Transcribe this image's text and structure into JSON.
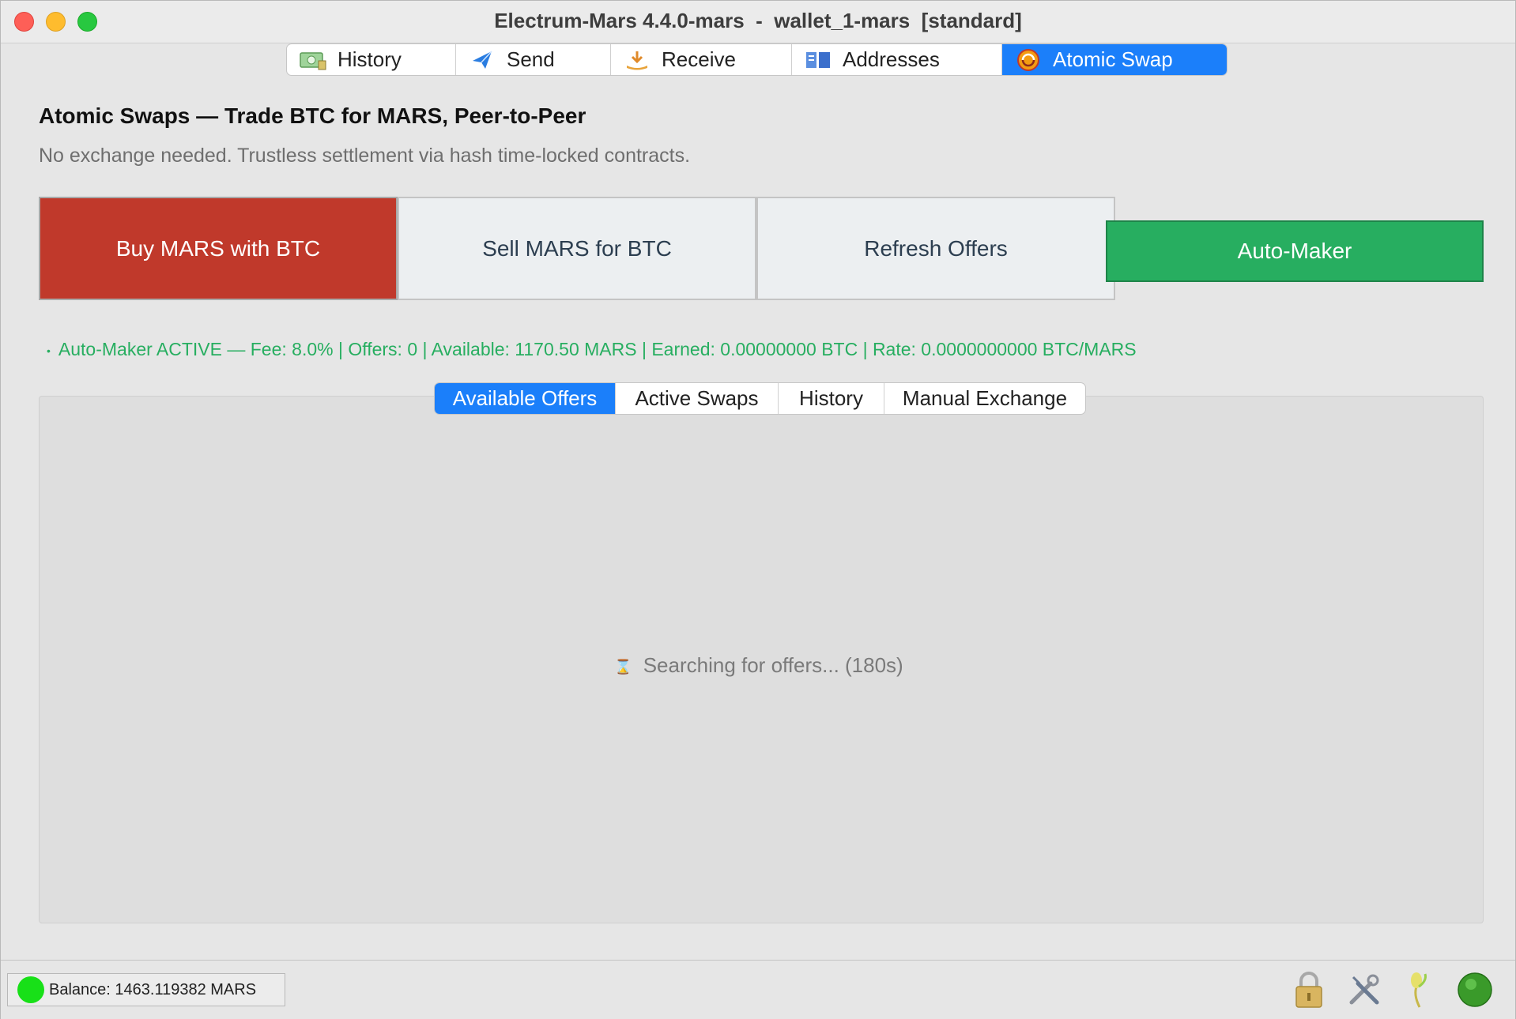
{
  "window": {
    "title": "Electrum-Mars 4.4.0-mars  -  wallet_1-mars  [standard]"
  },
  "main_tabs": [
    {
      "label": "History",
      "icon": "history-icon",
      "active": false
    },
    {
      "label": "Send",
      "icon": "send-icon",
      "active": false
    },
    {
      "label": "Receive",
      "icon": "receive-icon",
      "active": false
    },
    {
      "label": "Addresses",
      "icon": "addresses-icon",
      "active": false
    },
    {
      "label": "Atomic Swap",
      "icon": "atomic-swap-icon",
      "active": true
    }
  ],
  "content": {
    "heading": "Atomic Swaps — Trade BTC for MARS, Peer-to-Peer",
    "subheading": "No exchange needed. Trustless settlement via hash time-locked contracts.",
    "buttons": {
      "buy": "Buy MARS with BTC",
      "sell": "Sell MARS for BTC",
      "refresh": "Refresh Offers",
      "auto_maker": "Auto-Maker"
    },
    "status": {
      "bullet": "•",
      "text": "Auto-Maker ACTIVE — Fee: 8.0% | Offers: 0 | Available: 1170.50 MARS | Earned: 0.00000000 BTC | Rate: 0.0000000000 BTC/MARS"
    },
    "sub_tabs": [
      {
        "label": "Available Offers",
        "active": true
      },
      {
        "label": "Active Swaps",
        "active": false
      },
      {
        "label": "History",
        "active": false
      },
      {
        "label": "Manual Exchange",
        "active": false
      }
    ],
    "searching": {
      "glyph": "⌛",
      "text": "Searching for offers... (180s)"
    }
  },
  "statusbar": {
    "balance": "Balance: 1463.119382 MARS"
  },
  "colors": {
    "accent": "#1b7ffa",
    "buy": "#c0392b",
    "auto_maker": "#27ae60",
    "status_text": "#27ae60"
  }
}
